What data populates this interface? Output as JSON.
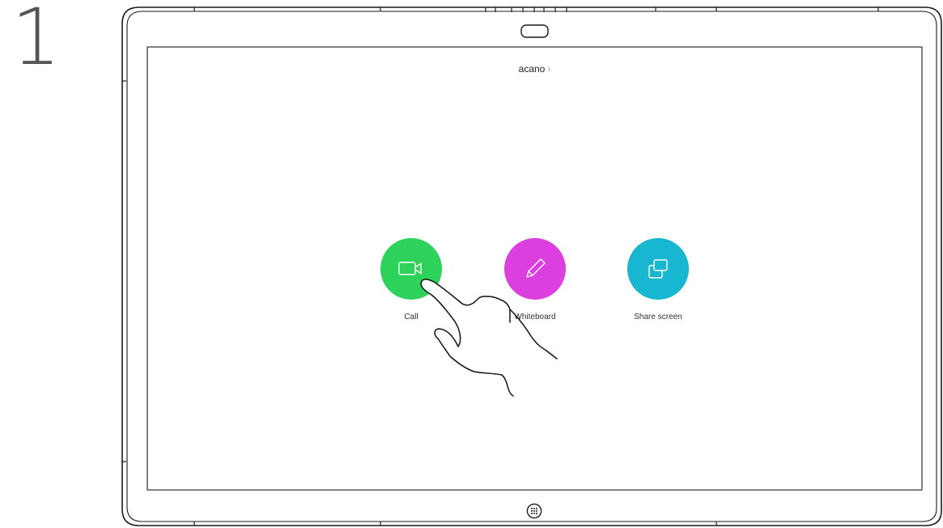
{
  "step": {
    "number": "1"
  },
  "header": {
    "room_name": "acano",
    "chevron": "›"
  },
  "apps": [
    {
      "label": "Call",
      "icon": "video-camera-icon",
      "color": "#2ed15a"
    },
    {
      "label": "Whiteboard",
      "icon": "pencil-icon",
      "color": "#dc3fe0"
    },
    {
      "label": "Share screen",
      "icon": "share-screen-icon",
      "color": "#19b6d2"
    }
  ],
  "footer": {
    "icon": "keypad-icon"
  },
  "illustration": {
    "pointer": "hand-pointer-icon"
  }
}
